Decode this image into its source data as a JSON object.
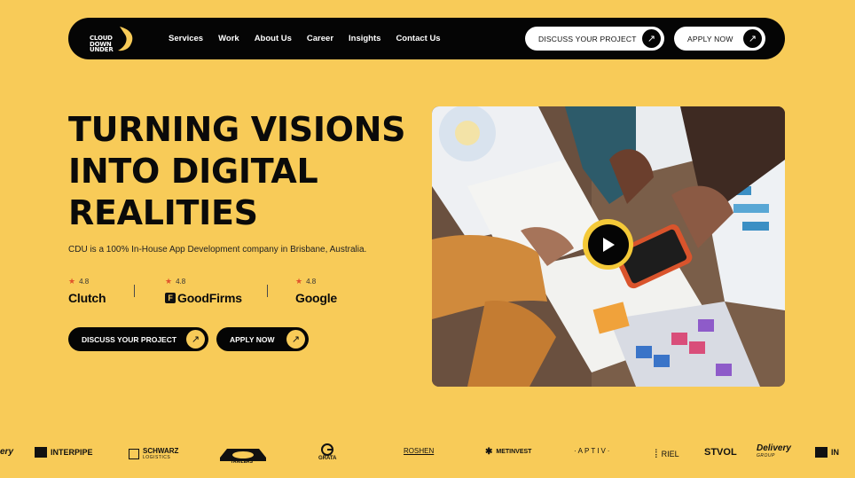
{
  "brand": {
    "logo_lines": [
      "CLOUD",
      "DOWN",
      "UNDER"
    ]
  },
  "nav": {
    "links": [
      "Services",
      "Work",
      "About Us",
      "Career",
      "Insights",
      "Contact Us"
    ],
    "discuss_label": "DISCUSS YOUR PROJECT",
    "apply_label": "APPLY NOW",
    "arrow": "↗"
  },
  "hero": {
    "headline": [
      "TURNING VISIONS",
      "INTO DIGITAL",
      "REALITIES"
    ],
    "subtitle": "CDU is a 100% In-House App Development company in Brisbane, Australia.",
    "ratings": [
      {
        "platform": "Clutch",
        "score": "4.8"
      },
      {
        "platform": "GoodFirms",
        "score": "4.8"
      },
      {
        "platform": "Google",
        "score": "4.8"
      }
    ],
    "cta_discuss": "DISCUSS YOUR PROJECT",
    "cta_apply": "APPLY NOW",
    "arrow": "↗"
  },
  "media": {
    "play_icon": "play-icon"
  },
  "clients": {
    "interpipe": "INTERPIPE",
    "schwarz": "SCHWARZ",
    "schwarz_sub": "LOGISTICS",
    "trailers": "TRAILERS",
    "grata": "GRATA",
    "roshen": "ROSHEN",
    "metinvest": "METINVEST",
    "aptiv": "·APTIV·",
    "riel": "RIEL",
    "stvol": "STVOL",
    "delivery": "Delivery",
    "delivery_sub": "GROUP",
    "cut_left": "ery",
    "cut_right": "IN"
  },
  "colors": {
    "background": "#f8cb58",
    "dark": "#050505",
    "accent_star": "#e0532b"
  }
}
